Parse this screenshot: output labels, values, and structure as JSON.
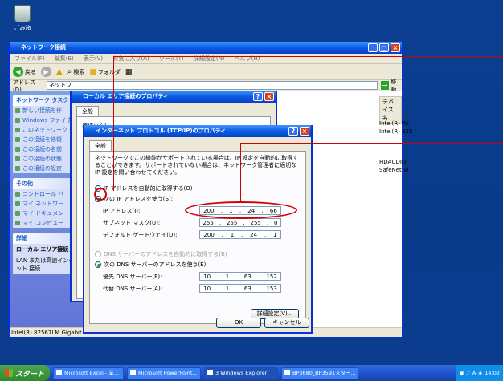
{
  "desktop": {
    "recycle_label": "ごみ箱"
  },
  "explorer": {
    "title": "ネットワーク接続",
    "menu": [
      "ファイル(F)",
      "編集(E)",
      "表示(V)",
      "お気に入り(A)",
      "ツール(T)",
      "詳細設定(N)",
      "ヘルプ(H)"
    ],
    "back_label": "戻る",
    "search_label": "検索",
    "folders_label": "フォルダ",
    "address_label": "アドレス(D)",
    "address_value": "ネットワ",
    "go_label": "移動",
    "column_device": "デバイス名",
    "devices": [
      "Intel(R) Wi",
      "Intel(R) 825",
      "HDAUDIO",
      "SafeNet Vi"
    ],
    "taskpane": {
      "network_head": "ネットワーク タスク",
      "network_items": [
        "新しい接続を作",
        "Windows ファイ 設定を変更す",
        "このネットワーク 化する",
        "この接続を修復",
        "この接続の名前",
        "この接続の状態",
        "この接続の設定"
      ],
      "other_head": "その他",
      "other_items": [
        "コントロール パ",
        "マイ ネットワー",
        "マイ ドキュメン",
        "マイ コンピュー"
      ],
      "detail_head": "詳細",
      "detail_title": "ローカル エリア接続",
      "detail_text": "LAN または高速インターネット 接続"
    },
    "status_text": "Intel(R) 82567LM Gigabit Net"
  },
  "lan_props": {
    "title": "ローカル エリア接続のプロパティ",
    "tab": "全般",
    "label_connect": "接続の方法"
  },
  "tcpip": {
    "title": "インターネット プロトコル (TCP/IP)のプロパティ",
    "tab": "全般",
    "description": "ネットワークでこの機能がサポートされている場合は、IP 設定を自動的に取得することができます。サポートされていない場合は、ネットワーク管理者に適切な IP 設定を問い合わせてください。",
    "auto_ip": "IP アドレスを自動的に取得する(O)",
    "manual_ip": "次の IP アドレスを使う(S):",
    "ip_label": "IP アドレス(I):",
    "ip": [
      "200",
      "1",
      "24",
      "66"
    ],
    "mask_label": "サブネット マスク(U):",
    "mask": [
      "255",
      "255",
      "255",
      "0"
    ],
    "gateway_label": "デフォルト ゲートウェイ(D):",
    "gateway": [
      "200",
      "1",
      "24",
      "1"
    ],
    "auto_dns": "DNS サーバーのアドレスを自動的に取得する(B)",
    "manual_dns": "次の DNS サーバーのアドレスを使う(E):",
    "dns1_label": "優先 DNS サーバー(P):",
    "dns1": [
      "10",
      "1",
      "63",
      "152"
    ],
    "dns2_label": "代替 DNS サーバー(A):",
    "dns2": [
      "10",
      "1",
      "63",
      "153"
    ],
    "advanced": "詳細設定(V)...",
    "ok": "OK",
    "cancel": "キャンセル"
  },
  "taskbar": {
    "start": "スタート",
    "tasks": [
      "Microsoft Excel - 業...",
      "Microsoft PowerPoint...",
      "3 Windows Explorer",
      "BP3680_BP3591スター..."
    ],
    "clock": "14:02"
  },
  "colors": {
    "annotation": "#d00000",
    "xp_blue": "#0831d9",
    "desktop": "#0a3a8a"
  }
}
